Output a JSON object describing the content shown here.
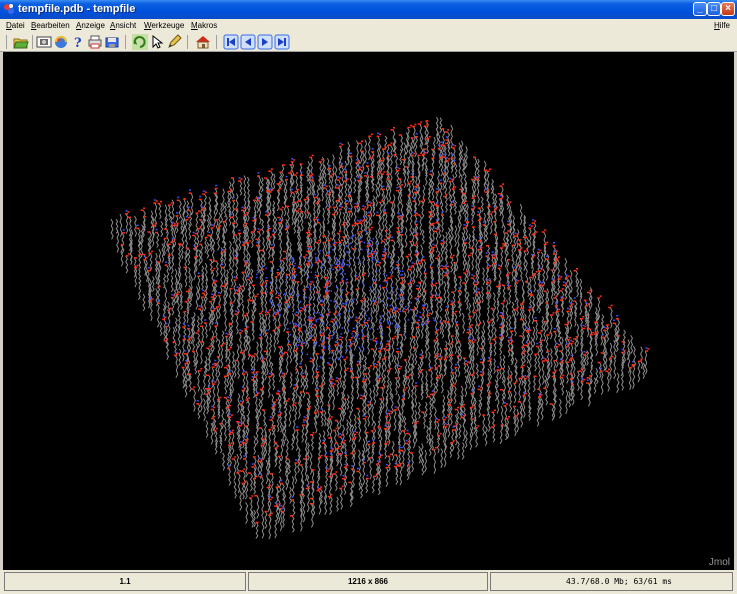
{
  "window": {
    "title": "tempfile.pdb - tempfile",
    "buttons": [
      "minimize-icon",
      "maximize-icon",
      "close-icon"
    ]
  },
  "menubar": {
    "items": [
      "Datei",
      "Bearbeiten",
      "Anzeige",
      "Ansicht",
      "Werkzeuge",
      "Makros"
    ],
    "help": "Hilfe"
  },
  "toolbar": {
    "icons": [
      "open-folder-icon",
      "screenshot-icon",
      "rotate-scene-icon",
      "help-icon",
      "print-icon",
      "save-icon",
      "rotate-molecule-icon",
      "select-pointer-icon",
      "pencil-icon",
      "home-icon",
      "first-frame-icon",
      "previous-frame-icon",
      "next-frame-icon",
      "last-frame-icon"
    ]
  },
  "viewer": {
    "watermark": "Jmol",
    "atom_colors": {
      "carbon": "#8c8c8c",
      "oxygen": "#ff2d12",
      "nitrogen": "#3b4fff"
    }
  },
  "statusbar": {
    "frame": "1.1",
    "dimensions": "1216 x 866",
    "memory": "43.7/68.0 Mb;  63/61 ms"
  }
}
